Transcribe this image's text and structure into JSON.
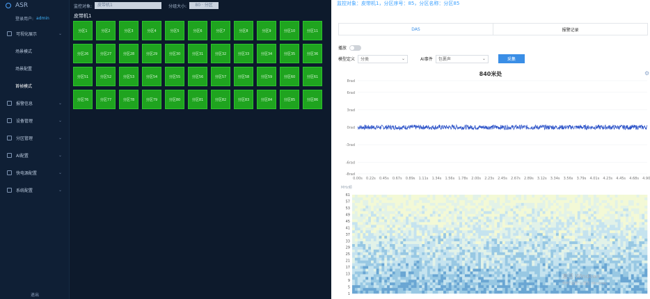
{
  "sidebar": {
    "logo": "ASR",
    "user_label": "登录用户:",
    "user_name": "admin",
    "menu": [
      {
        "label": "可视化展示",
        "type": "group"
      },
      {
        "label": "场景模式",
        "type": "sub"
      },
      {
        "label": "场景配置",
        "type": "sub"
      },
      {
        "label": "首帧模式",
        "type": "sub",
        "active": true
      },
      {
        "label": "报警信息",
        "type": "group"
      },
      {
        "label": "设备管理",
        "type": "group"
      },
      {
        "label": "分区管理",
        "type": "group"
      },
      {
        "label": "AI配置",
        "type": "group"
      },
      {
        "label": "快电源配置",
        "type": "group"
      },
      {
        "label": "系统配置",
        "type": "group"
      }
    ],
    "footer": "退出"
  },
  "topbar": {
    "label1": "监控对象:",
    "select1": "皮带机1",
    "label2": "分组大小:",
    "select2": "80 · 分区"
  },
  "main": {
    "section_title": "皮带机1",
    "rows": [
      [
        "分区1",
        "分区2",
        "分区3",
        "分区4",
        "分区5",
        "分区6",
        "分区7",
        "分区8",
        "分区9",
        "分区10",
        "分区11"
      ],
      [
        "分区26",
        "分区27",
        "分区28",
        "分区29",
        "分区30",
        "分区31",
        "分区32",
        "分区33",
        "分区34",
        "分区35",
        "分区36"
      ],
      [
        "分区51",
        "分区52",
        "分区53",
        "分区54",
        "分区55",
        "分区56",
        "分区57",
        "分区58",
        "分区59",
        "分区60",
        "分区61"
      ],
      [
        "分区76",
        "分区77",
        "分区78",
        "分区79",
        "分区80",
        "分区81",
        "分区82",
        "分区83",
        "分区84",
        "分区85",
        "分区86"
      ]
    ]
  },
  "panel": {
    "title": "监控对象：皮带机1，分区序号：85，分区名称：分区85",
    "tabs": [
      "DAS",
      "报警记录"
    ],
    "play_label": "播放",
    "filter1_label": "模型定义",
    "filter1_value": "分类",
    "filter2_label": "AI事件",
    "filter2_value": "包裹声",
    "button": "采集",
    "chart_title": "840米处",
    "heat_label": "MHz频",
    "watermark1": "激活 Windows",
    "watermark2": "转到\"设置\"以激活 Windows。"
  },
  "colors": {
    "tile": "#1fa41f",
    "accent": "#3a8ee6",
    "wave": "#2f55c9"
  },
  "chart_data": [
    {
      "type": "line",
      "title": "840米处",
      "ylim": [
        -8,
        8
      ],
      "yticks": [
        "8rad",
        "6rad",
        "3rad",
        "0rad",
        "-3rad",
        "-6rad",
        "-8rad"
      ],
      "yvals": [
        8,
        6,
        3,
        0,
        -3,
        -6,
        -8
      ],
      "xticks": [
        "0.00s",
        "0.22s",
        "0.45s",
        "0.67s",
        "0.89s",
        "1.11s",
        "1.34s",
        "1.56s",
        "1.78s",
        "2.00s",
        "2.23s",
        "2.45s",
        "2.67s",
        "2.89s",
        "3.12s",
        "3.34s",
        "3.56s",
        "3.79s",
        "4.01s",
        "4.23s",
        "4.45s",
        "4.68s",
        "4.90s"
      ],
      "amplitude": 0.4,
      "grid": true
    },
    {
      "type": "heatmap",
      "yticks": [
        61,
        57,
        53,
        49,
        45,
        41,
        37,
        33,
        29,
        25,
        21,
        17,
        13,
        9,
        5,
        1
      ],
      "grid": false
    }
  ]
}
